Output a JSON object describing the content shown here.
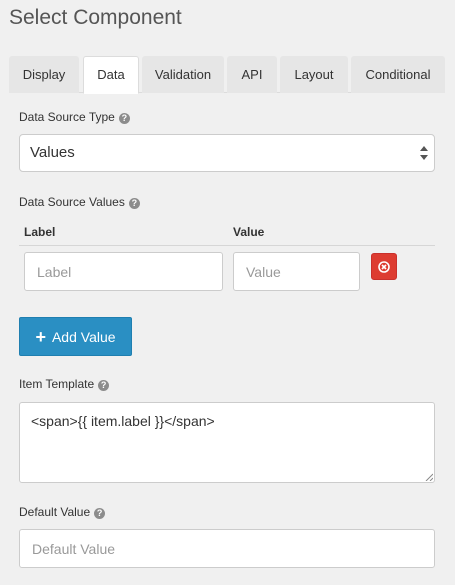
{
  "title": "Select Component",
  "tabs": [
    {
      "label": "Display",
      "active": false
    },
    {
      "label": "Data",
      "active": true
    },
    {
      "label": "Validation",
      "active": false
    },
    {
      "label": "API",
      "active": false
    },
    {
      "label": "Layout",
      "active": false
    },
    {
      "label": "Conditional",
      "active": false
    }
  ],
  "data_source_type": {
    "label": "Data Source Type",
    "value": "Values",
    "help_icon": "question-circle-icon"
  },
  "data_source_values": {
    "label": "Data Source Values",
    "help_icon": "question-circle-icon",
    "columns": {
      "label": "Label",
      "value": "Value"
    },
    "rows": [
      {
        "label_placeholder": "Label",
        "value_placeholder": "Value",
        "remove_icon": "times-circle-icon"
      }
    ],
    "add_button_label": "Add Value",
    "add_icon": "plus-icon"
  },
  "item_template": {
    "label": "Item Template",
    "value": "<span>{{ item.label }}</span>",
    "help_icon": "question-circle-icon"
  },
  "default_value": {
    "label": "Default Value",
    "placeholder": "Default Value",
    "help_icon": "question-circle-icon"
  },
  "colors": {
    "add_button": "#2a8fc3",
    "remove_button": "#dd3c31"
  }
}
